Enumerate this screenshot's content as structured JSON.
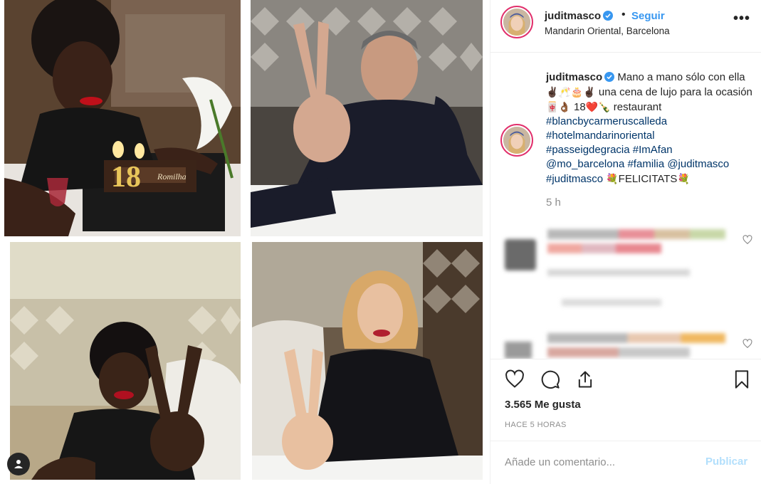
{
  "post": {
    "username": "juditmasco",
    "follow_label": "Seguir",
    "separator": "•",
    "location": "Mandarin Oriental, Barcelona",
    "more_label": "•••",
    "caption": {
      "username": "juditmasco",
      "text_1": "Mano a mano sólo con ella",
      "emoji_1": "✌🏿🥂🎂✌🏿",
      "text_2": "una cena de lujo para la ocasión",
      "emoji_2": "🀄👌🏾",
      "text_3": "18",
      "emoji_3": "❤️🍾",
      "text_4": "restaurant",
      "hashtags": [
        "#blancbycarmeruscalleda",
        "#hotelmandarinoriental",
        "#passeigdegracia",
        "#ImAfan",
        "@mo_barcelona",
        "#familia",
        "@juditmasco",
        "#juditmasco"
      ],
      "emoji_4": "💐",
      "text_5": "FELICITATS",
      "emoji_5": "💐"
    },
    "time_ago": "5 h",
    "likes": "3.565 Me gusta",
    "when": "HACE 5 HORAS",
    "comment_placeholder": "Añade un comentario...",
    "publish_label": "Publicar",
    "cake_text": "18",
    "cake_plaque": "Romilha"
  },
  "icons": {
    "like": "heart-icon",
    "comment": "comment-icon",
    "share": "share-icon",
    "save": "bookmark-icon",
    "more": "more-icon",
    "tag": "user-tag-icon",
    "verified": "verified-badge-icon"
  },
  "colors": {
    "follow": "#3897f0",
    "publish_disabled": "#b2dffc",
    "hashtag": "#003569",
    "muted": "#8e8e8e",
    "story_ring": "#e1306c"
  }
}
